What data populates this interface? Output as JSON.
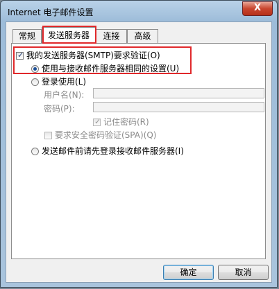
{
  "window": {
    "title": "Internet 电子邮件设置",
    "close_glyph": "X"
  },
  "tabs": [
    {
      "label": "常规"
    },
    {
      "label": "发送服务器"
    },
    {
      "label": "连接"
    },
    {
      "label": "高级"
    }
  ],
  "auth": {
    "require_auth_label": "我的发送服务器(SMTP)要求验证(O)",
    "require_auth_checked": true,
    "same_settings_label": "使用与接收邮件服务器相同的设置(U)",
    "same_settings_selected": true,
    "login_label": "登录使用(L)",
    "login_selected": false,
    "username_label": "用户名(N):",
    "username_value": "",
    "password_label": "密码(P):",
    "password_value": "",
    "remember_password_label": "记住密码(R)",
    "remember_password_checked": true,
    "spa_label": "要求安全密码验证(SPA)(Q)",
    "spa_checked": false,
    "login_before_send_label": "发送邮件前请先登录接收邮件服务器(I)",
    "login_before_send_selected": false
  },
  "buttons": {
    "ok_label": "确定",
    "cancel_label": "取消"
  }
}
